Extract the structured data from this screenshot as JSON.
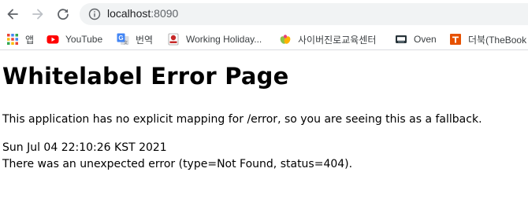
{
  "browser": {
    "url_host": "localhost",
    "url_port": ":8090"
  },
  "bookmarks": [
    {
      "label": "앱",
      "icon": "apps-grid-icon"
    },
    {
      "label": "YouTube",
      "icon": "youtube-icon"
    },
    {
      "label": "번역",
      "icon": "google-translate-icon"
    },
    {
      "label": "Working Holiday...",
      "icon": "working-holiday-icon"
    },
    {
      "label": "사이버진로교육센터",
      "icon": "cyber-career-icon"
    },
    {
      "label": "Oven",
      "icon": "oven-icon"
    },
    {
      "label": "더북(TheBook",
      "icon": "thebook-icon"
    }
  ],
  "page": {
    "title": "Whitelabel Error Page",
    "message": "This application has no explicit mapping for /error, so you are seeing this as a fallback.",
    "timestamp": "Sun Jul 04 22:10:26 KST 2021",
    "error": "There was an unexpected error (type=Not Found, status=404)."
  },
  "colors": {
    "omnibox_bg": "#f1f3f4",
    "youtube_red": "#ff0000",
    "bookmark_text": "#3c4043"
  }
}
